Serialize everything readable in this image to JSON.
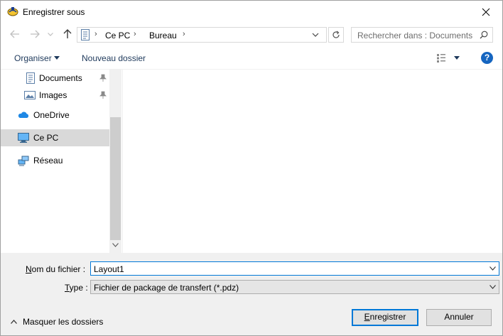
{
  "window": {
    "title": "Enregistrer sous"
  },
  "nav": {
    "crumbs": [
      "Ce PC",
      "Bureau"
    ],
    "search_placeholder": "Rechercher dans : Documents"
  },
  "toolbar": {
    "organise_label": "Organiser",
    "new_folder_label": "Nouveau dossier",
    "help_label": "?"
  },
  "sidebar": {
    "items": [
      {
        "label": "Documents",
        "icon": "documents-icon",
        "pinned": true
      },
      {
        "label": "Images",
        "icon": "images-icon",
        "pinned": true
      },
      {
        "label": "OneDrive",
        "icon": "onedrive-icon",
        "pinned": false
      },
      {
        "label": "Ce PC",
        "icon": "computer-icon",
        "pinned": false,
        "selected": true
      },
      {
        "label": "Réseau",
        "icon": "network-icon",
        "pinned": false
      }
    ]
  },
  "form": {
    "filename_label_u": "N",
    "filename_label_rest": "om du fichier :",
    "filename_value": "Layout1",
    "type_label_u": "T",
    "type_label_rest": "ype :",
    "type_value": "Fichier de package de transfert (*.pdz)",
    "hide_folders_label": "Masquer les dossiers",
    "save_label_u": "E",
    "save_label_rest": "nregistrer",
    "cancel_label": "Annuler"
  },
  "colors": {
    "accent": "#0078d7",
    "selection": "#d9d9d9",
    "help_blue": "#1565c0",
    "onedrive_blue": "#1e88e5"
  }
}
